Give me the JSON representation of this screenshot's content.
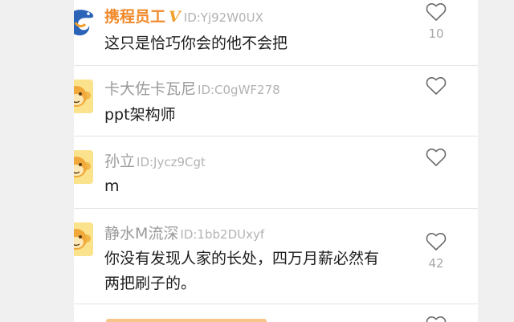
{
  "comments": [
    {
      "username": "携程员工",
      "vip": true,
      "badge": "V",
      "id": "ID:Yj92W0UX",
      "text": "这只是恰巧你会的他不会把",
      "likes": "10",
      "avatar": "ctrip-dolphin-logo"
    },
    {
      "username": "卡大佐卡瓦尼",
      "id": "ID:C0gWF278",
      "text": "ppt架构师",
      "likes": "",
      "avatar": "monkey-avatar"
    },
    {
      "username": "孙立",
      "id": "ID:Jycz9Cgt",
      "text": "m",
      "likes": "",
      "avatar": "monkey-avatar"
    },
    {
      "username": "静水M流深",
      "id": "ID:1bb2DUxyf",
      "text": "你没有发现人家的长处，四万月薪必然有两把刷子的。",
      "likes": "42",
      "avatar": "monkey-avatar"
    }
  ],
  "colors": {
    "vip_name": "#f0892a",
    "normal_name": "#9a9a9a",
    "uid": "#b3b3b3",
    "text": "#1e1e1e"
  }
}
